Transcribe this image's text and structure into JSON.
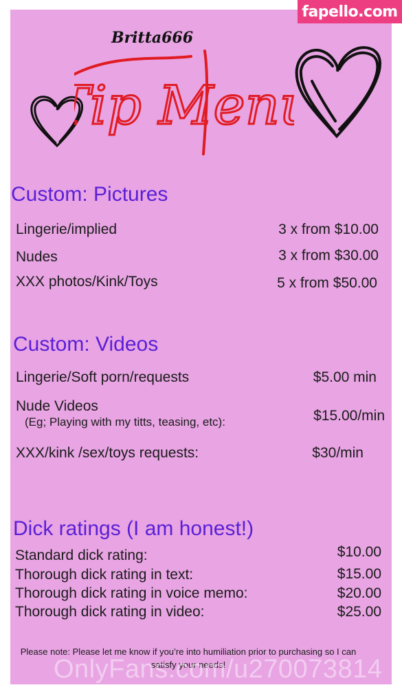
{
  "watermark_top": "fapello.com",
  "handle": "Britta666",
  "title": "Tip Menu",
  "colors": {
    "background": "#e8a4e3",
    "section_title": "#5a1fd6",
    "title_red": "#e11b22",
    "watermark_pink": "#ee3e82"
  },
  "sections": [
    {
      "title": "Custom: Pictures",
      "rows": [
        {
          "label": "Lingerie/implied",
          "price": "3 x from $10.00"
        },
        {
          "label": "Nudes",
          "price": "3 x from $30.00"
        },
        {
          "label": "XXX photos/Kink/Toys",
          "price": "5 x from $50.00"
        }
      ]
    },
    {
      "title": "Custom: Videos",
      "rows": [
        {
          "label": "Lingerie/Soft porn/requests",
          "price": "$5.00 min"
        },
        {
          "label": "Nude Videos",
          "sub": "(Eg; Playing with my titts, teasing, etc):",
          "price": "$15.00/min"
        },
        {
          "label": "XXX/kink /sex/toys requests:",
          "price": "$30/min"
        }
      ]
    },
    {
      "title": "Dick ratings (I am honest!)",
      "rows": [
        {
          "label": "Standard dick rating:",
          "price": "$10.00"
        },
        {
          "label": "Thorough dick rating in text:",
          "price": "$15.00"
        },
        {
          "label": "Thorough dick rating in voice memo:",
          "price": "$20.00"
        },
        {
          "label": "Thorough dick rating in video:",
          "price": "$25.00"
        }
      ]
    }
  ],
  "note": "Please note: Please let me know if you’re into humiliation prior to purchasing so I can satisfy your needs!",
  "watermark_bottom": "OnlyFans.com/u270073814"
}
